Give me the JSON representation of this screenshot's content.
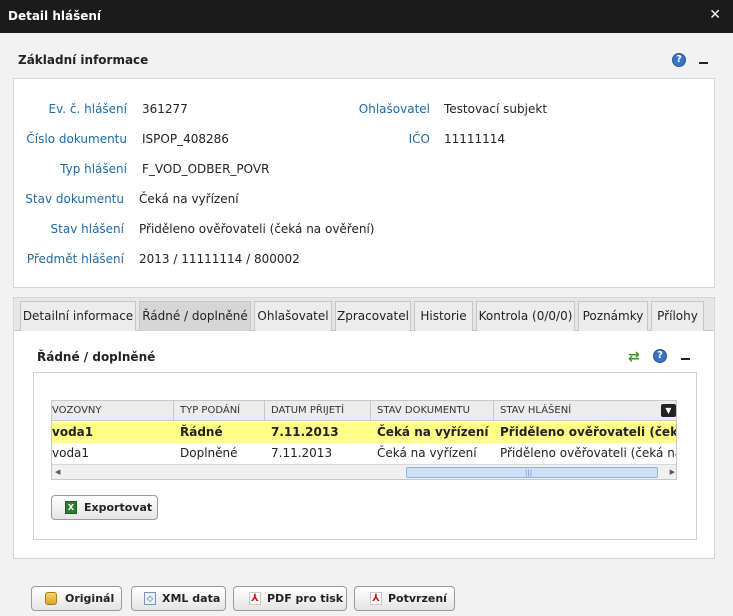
{
  "window": {
    "title": "Detail hlášení",
    "close_glyph": "✕"
  },
  "basic_info": {
    "title": "Základní informace",
    "left_fields": [
      {
        "label": "Ev. č. hlášení",
        "value": "361277"
      },
      {
        "label": "Číslo dokumentu",
        "value": "ISPOP_408286"
      },
      {
        "label": "Typ hlášení",
        "value": "F_VOD_ODBER_POVR"
      },
      {
        "label": "Stav dokumentu",
        "value": "Čeká na vyřízení"
      },
      {
        "label": "Stav hlášení",
        "value": "Přiděleno ověřovateli (čeká na ověření)"
      },
      {
        "label": "Předmět hlášení",
        "value": "2013 / 11111114 / 800002"
      }
    ],
    "right_fields": [
      {
        "label": "Ohlašovatel",
        "value": "Testovací subjekt"
      },
      {
        "label": "IČO",
        "value": "11111114"
      }
    ]
  },
  "tabs": [
    {
      "label": "Detailní informace"
    },
    {
      "label": "Řádné / doplněné"
    },
    {
      "label": "Ohlašovatel"
    },
    {
      "label": "Zpracovatel"
    },
    {
      "label": "Historie"
    },
    {
      "label": "Kontrola (0/0/0)"
    },
    {
      "label": "Poznámky"
    },
    {
      "label": "Přílohy"
    }
  ],
  "active_tab": "Řádné / doplněné",
  "subpanel": {
    "title": "Řádné / doplněné",
    "columns": [
      "VOZOVNY",
      "TYP PODÁNÍ",
      "DATUM PŘIJETÍ",
      "STAV DOKUMENTU",
      "STAV HLÁŠENÍ"
    ],
    "rows": [
      {
        "cells": [
          "voda1",
          "Řádné",
          "7.11.2013",
          "Čeká na vyřízení",
          "Přiděleno ověřovateli (čeká na ověření)"
        ],
        "selected": true
      },
      {
        "cells": [
          "voda1",
          "Doplněné",
          "7.11.2013",
          "Čeká na vyřízení",
          "Přiděleno ověřovateli (čeká na ověření)"
        ],
        "selected": false
      }
    ],
    "export_label": "Exportovat"
  },
  "footer_buttons": [
    {
      "label": "Originál",
      "icon": "database-icon"
    },
    {
      "label": "XML data",
      "icon": "xml-icon"
    },
    {
      "label": "PDF pro tisk",
      "icon": "pdf-icon"
    },
    {
      "label": "Potvrzení",
      "icon": "pdf-icon"
    }
  ],
  "colors": {
    "label_blue": "#1c6aa6",
    "selected_row": "#ffff88",
    "titlebar": "#1b1b1b"
  }
}
